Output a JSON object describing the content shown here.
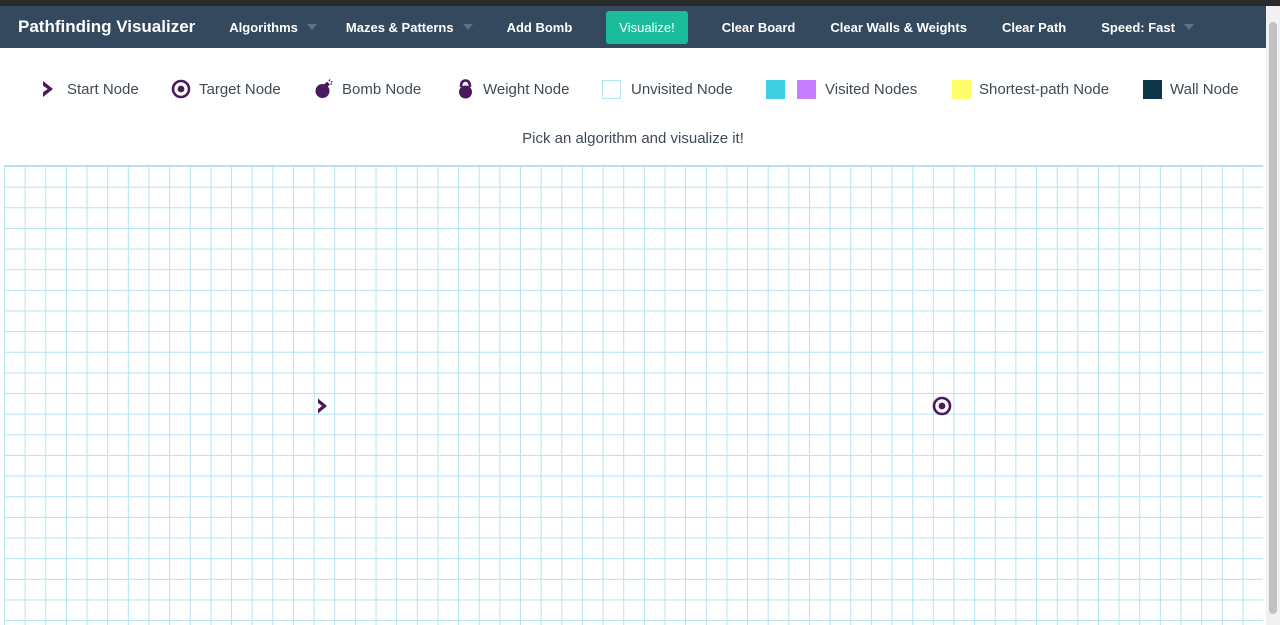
{
  "navbar": {
    "brand": "Pathfinding Visualizer",
    "algorithms_label": "Algorithms",
    "mazes_label": "Mazes & Patterns",
    "add_bomb_label": "Add Bomb",
    "visualize_label": "Visualize!",
    "clear_board_label": "Clear Board",
    "clear_walls_label": "Clear Walls & Weights",
    "clear_path_label": "Clear Path",
    "speed_label": "Speed: Fast"
  },
  "legend": {
    "start": "Start Node",
    "target": "Target Node",
    "bomb": "Bomb Node",
    "weight": "Weight Node",
    "unvisited": "Unvisited Node",
    "visited": "Visited Nodes",
    "shortest": "Shortest-path Node",
    "wall": "Wall Node"
  },
  "subtitle": "Pick an algorithm and visualize it!",
  "colors": {
    "navbar": "#34495e",
    "accent": "#1abc9c",
    "grid_line": "#b3e3f1",
    "node_icon": "#4a1a5e",
    "visited_cyan": "#40cee3",
    "visited_purple": "#c77dff",
    "shortest_path": "#fffe6a",
    "wall": "#0c3547"
  },
  "icons": {
    "start": "chevron-right-icon",
    "target": "bullseye-icon",
    "bomb": "bomb-icon",
    "weight": "kettlebell-icon"
  }
}
